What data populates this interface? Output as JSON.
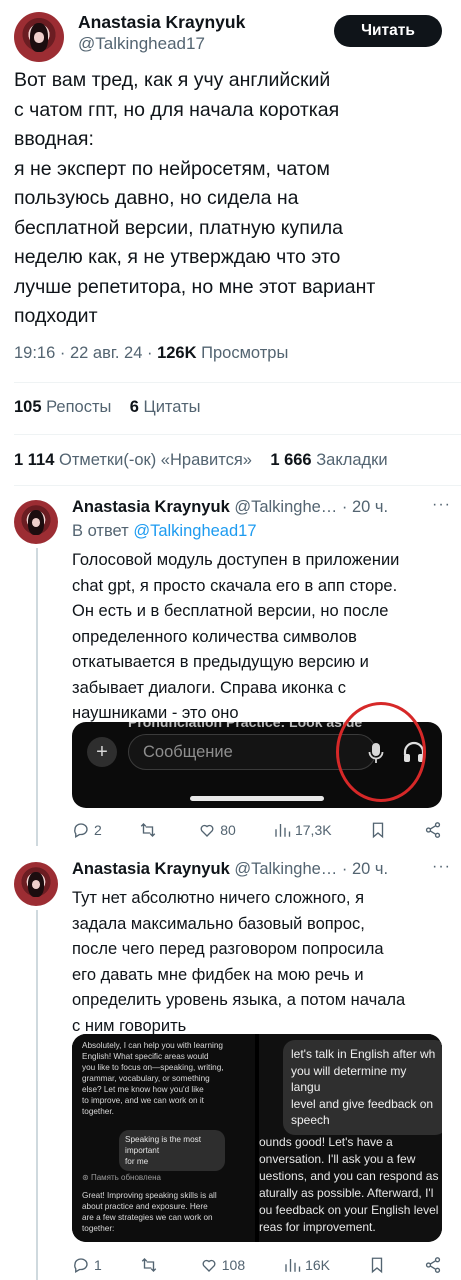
{
  "main_tweet": {
    "author_name": "Anastasia Kraynyuk",
    "handle": "@Talkinghead17",
    "read_button": "Читать",
    "more": "···",
    "text": "Вот вам тред, как я учу английский\nс чатом гпт, но для начала короткая\nвводная:\nя не эксперт по нейросетям, чатом\nпользуюсь давно, но сидела на\nбесплатной версии, платную купила\nнеделю как, я не утверждаю что это\nлучше репетитора, но мне этот вариант\nподходит",
    "time": "19:16",
    "date": "22 авг. 24",
    "views_count": "126K",
    "views_label": "Просмотры",
    "reposts_count": "105",
    "reposts_label": "Репосты",
    "quotes_count": "6",
    "quotes_label": "Цитаты",
    "likes_count": "1 114",
    "likes_label": "Отметки(-ок) «Нравится»",
    "bookmarks_count": "1 666",
    "bookmarks_label": "Закладки"
  },
  "replies": [
    {
      "author_name": "Anastasia Kraynyuk",
      "handle": "@Talkinghe…",
      "time_ago": "· 20 ч.",
      "more": "···",
      "in_reply_label": "В ответ",
      "in_reply_handle": "@Talkinghead17",
      "text": "Голосовой модуль доступен в приложении\nchat gpt, я просто скачала его в апп сторе.\nОн есть и в бесплатной версии, но после\nопределенного количества символов\nоткатывается в предыдущую версию и\nзабывает диалоги. Справа иконка с\nнаушниками - это оно",
      "media": {
        "cut_text": "Pronunciation Practice: Look aside",
        "placeholder": "Сообщение",
        "icons": [
          "plus-icon",
          "microphone-icon",
          "headphones-icon"
        ]
      },
      "actions": {
        "replies": "2",
        "reposts": "",
        "likes": "80",
        "views": "17,3K"
      }
    },
    {
      "author_name": "Anastasia Kraynyuk",
      "handle": "@Talkinghe…",
      "time_ago": "· 20 ч.",
      "more": "···",
      "text": "Тут нет абсолютно ничего сложного, я\nзадала максимально базовый вопрос,\nпосле чего перед разговором попросила\nего давать мне фидбек на мою речь и\nопределить уровень языка, а потом начала\nс ним говорить",
      "media": {
        "left_text_1": "Absolutely, I can help you with learning\nEnglish! What specific areas would\nyou like to focus on—speaking, writing,\ngrammar, vocabulary, or something\nelse? Let me know how you'd like\nto improve, and we can work on it\ntogether.",
        "left_bubble": "Speaking is the most important\nfor me",
        "memory_label": "Память обновлена",
        "left_text_2": "Great! Improving speaking skills is all\nabout practice and exposure. Here\nare a few strategies we can work on\ntogether:",
        "right_bubble": "let's talk in English after wh\nyou will determine my langu\nlevel and give feedback on\nspeech",
        "right_text": "ounds good! Let's have a\nonversation. I'll ask you a few\nuestions, and you can respond as\naturally as possible. Afterward, I'l\nou feedback on your English level\nreas for improvement."
      },
      "actions": {
        "replies": "1",
        "reposts": "",
        "likes": "108",
        "views": "16K"
      }
    }
  ]
}
